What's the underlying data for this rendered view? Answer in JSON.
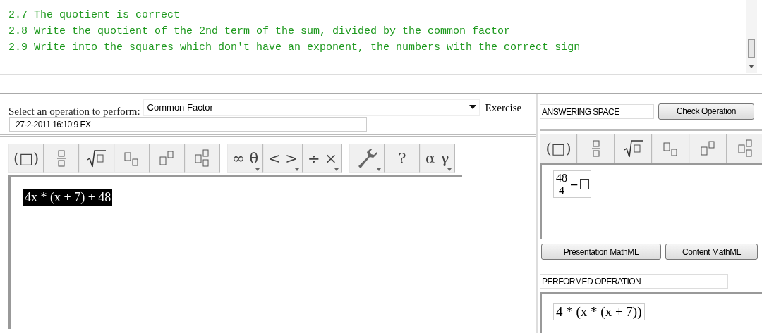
{
  "log": {
    "lines": [
      "2.7 The quotient is correct",
      "2.8 Write the quotient of the 2nd term of the sum, divided by the common factor",
      "2.9 Write into the squares which don't have an exponent, the numbers with the correct sign"
    ]
  },
  "operation": {
    "label": "Select an operation to perform:",
    "value": "Common Factor",
    "mode": "Exercise",
    "timestamp": "27-2-2011 16:10:9 EX"
  },
  "toolbar": {
    "groups": [
      [
        {
          "kind": "text",
          "glyph": "(□)",
          "has_menu": false
        },
        {
          "kind": "fraction",
          "has_menu": false
        },
        {
          "kind": "sqrt",
          "has_menu": false
        },
        {
          "kind": "subscript",
          "has_menu": false
        },
        {
          "kind": "superscript",
          "has_menu": false
        },
        {
          "kind": "subsup",
          "has_menu": false
        }
      ],
      [
        {
          "kind": "text",
          "glyph": "∞ θ",
          "has_menu": true
        },
        {
          "kind": "text",
          "glyph": "< >",
          "has_menu": true
        },
        {
          "kind": "text",
          "glyph": "÷ ×",
          "has_menu": true
        }
      ],
      [
        {
          "kind": "wrench",
          "has_menu": true
        },
        {
          "kind": "text",
          "glyph": "?",
          "has_menu": false
        },
        {
          "kind": "text",
          "glyph": "α γ",
          "has_menu": true
        }
      ]
    ]
  },
  "exercise_editor": {
    "expression": "4x * (x + 7) + 48",
    "selected": true
  },
  "answer": {
    "title": "ANSWERING SPACE",
    "check_button": "Check Operation",
    "toolbar": [
      {
        "kind": "text",
        "glyph": "(□)",
        "has_menu": false
      },
      {
        "kind": "fraction",
        "has_menu": false
      },
      {
        "kind": "sqrt",
        "has_menu": false
      },
      {
        "kind": "subscript",
        "has_menu": false
      },
      {
        "kind": "superscript",
        "has_menu": false
      },
      {
        "kind": "subsup",
        "has_menu": false
      }
    ],
    "numerator": "48",
    "denominator": "4",
    "relation": "=",
    "buttons": [
      "Presentation MathML",
      "Content MathML"
    ],
    "performed_title": "PERFORMED OPERATION",
    "performed": "4 * (x * (x + 7))"
  }
}
